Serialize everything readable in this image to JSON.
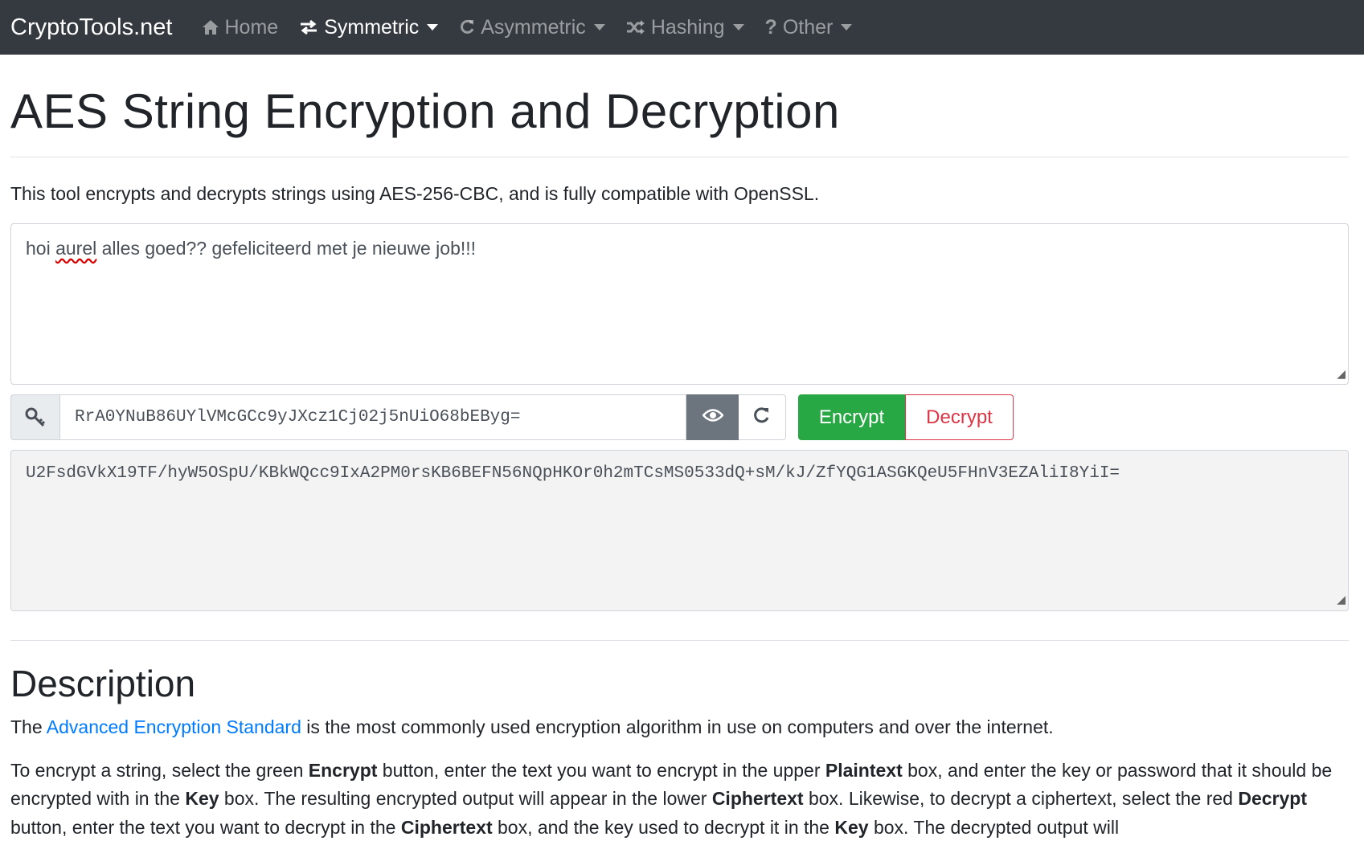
{
  "navbar": {
    "brand": "CryptoTools.net",
    "items": [
      {
        "label": "Home",
        "icon": "home-icon"
      },
      {
        "label": "Symmetric",
        "icon": "arrows-exchange-icon"
      },
      {
        "label": "Asymmetric",
        "icon": "refresh-icon"
      },
      {
        "label": "Hashing",
        "icon": "shuffle-icon"
      },
      {
        "label": "Other",
        "icon": "question-icon"
      }
    ]
  },
  "page": {
    "title": "AES String Encryption and Decryption",
    "lead": "This tool encrypts and decrypts strings using AES-256-CBC, and is fully compatible with OpenSSL."
  },
  "plaintext": {
    "before": "hoi ",
    "misspelled": "aurel",
    "after": " alles goed?? gefeliciteerd met je nieuwe job!!!"
  },
  "key": {
    "value": "RrA0YNuB86UYlVMcGCc9yJXcz1Cj02j5nUiO68bEByg="
  },
  "mode": {
    "encrypt_label": "Encrypt",
    "decrypt_label": "Decrypt",
    "selected": "Encrypt"
  },
  "ciphertext": {
    "value": "U2FsdGVkX19TF/hyW5OSpU/KBkWQcc9IxA2PM0rsKB6BEFN56NQpHKOr0h2mTCsMS0533dQ+sM/kJ/ZfYQG1ASGKQeU5FHnV3EZAliI8YiI="
  },
  "description": {
    "heading": "Description",
    "p1_before": "The ",
    "p1_link": "Advanced Encryption Standard",
    "p1_after": " is the most commonly used encryption algorithm in use on computers and over the internet.",
    "p2": {
      "t1": "To encrypt a string, select the green ",
      "b1": "Encrypt",
      "t2": " button, enter the text you want to encrypt in the upper ",
      "b2": "Plaintext",
      "t3": " box, and enter the key or password that it should be encrypted with in the ",
      "b3": "Key",
      "t4": " box. The resulting encrypted output will appear in the lower ",
      "b4": "Ciphertext",
      "t5": " box. Likewise, to decrypt a ciphertext, select the red ",
      "b5": "Decrypt",
      "t6": " button, enter the text you want to decrypt in the ",
      "b6": "Ciphertext",
      "t7": " box, and the key used to decrypt it in the ",
      "b7": "Key",
      "t8": " box. The decrypted output will"
    }
  },
  "colors": {
    "navbar_bg": "#343a40",
    "encrypt_green": "#28a745",
    "decrypt_red": "#dc3545",
    "link_blue": "#007bff"
  }
}
